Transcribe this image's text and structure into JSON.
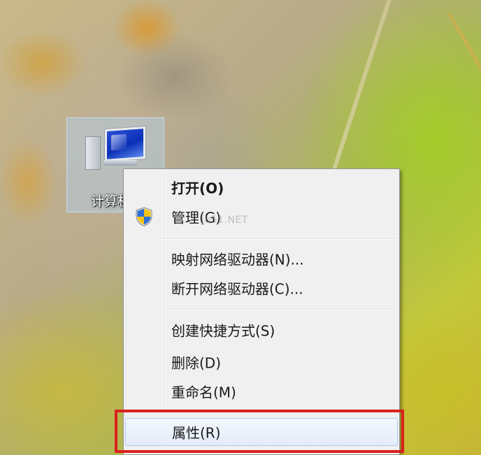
{
  "desktop": {
    "icon_label": "计算机"
  },
  "context_menu": {
    "items": [
      {
        "label": "打开(O)",
        "bold": true
      },
      {
        "label": "管理(G)",
        "icon": "uac-shield-icon"
      },
      {
        "label": "映射网络驱动器(N)..."
      },
      {
        "label": "断开网络驱动器(C)..."
      },
      {
        "label": "创建快捷方式(S)"
      },
      {
        "label": "删除(D)"
      },
      {
        "label": "重命名(M)"
      },
      {
        "label": "属性(R)",
        "highlighted": true
      }
    ],
    "watermark": "jb51.NET"
  },
  "annotation": {
    "color": "#d9221c"
  }
}
